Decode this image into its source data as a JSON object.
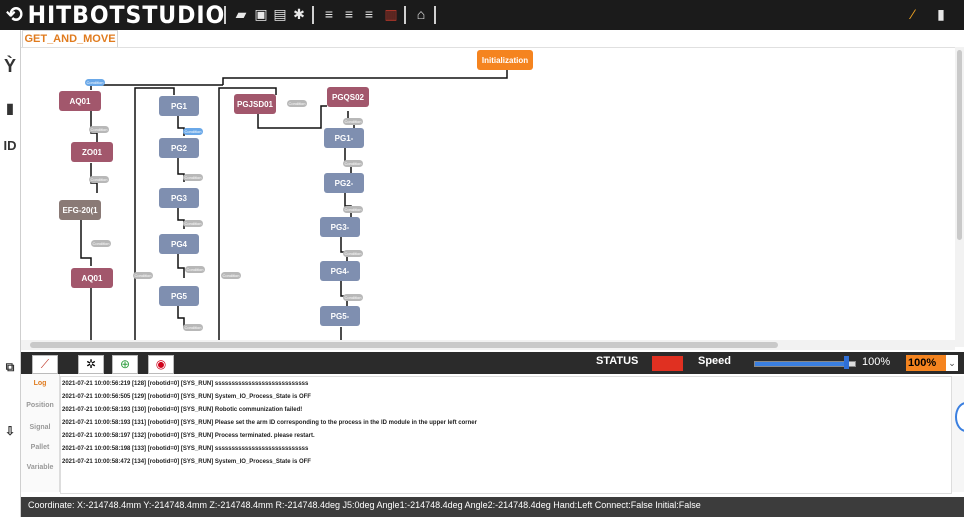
{
  "app": {
    "brand": "HITBOTSTUDIO"
  },
  "tabs": [
    {
      "label": "GET_AND_MOVE"
    }
  ],
  "flow": {
    "start": "Initialization",
    "col1": [
      "AQ01",
      "ZO01",
      "EFG-20(1",
      "AQ01"
    ],
    "col2": [
      "PG1",
      "PG2",
      "PG3",
      "PG4",
      "PG5"
    ],
    "col3_head": "PGJSD01",
    "col4": [
      "PGQS02",
      "PG1-",
      "PG2-",
      "PG3-",
      "PG4-",
      "PG5-"
    ],
    "condition_label": "Condition"
  },
  "toolbar": {
    "status_label": "STATUS",
    "status_color": "#e03021",
    "speed_label": "Speed",
    "speed_value": "100%",
    "speed_fraction": 1.0,
    "speed_select": "100%"
  },
  "side_tabs": [
    "Log",
    "Position",
    "Signal",
    "Pallet",
    "Variable"
  ],
  "log": [
    "2021-07-21 10:00:56:219 [128] [robotid=0] [SYS_RUN] ssssssssssssssssssssssssssss",
    "2021-07-21 10:00:56:505 [129] [robotid=0] [SYS_RUN] System_IO_Process_State is OFF",
    "2021-07-21 10:00:58:193 [130] [robotid=0] [SYS_RUN] Robotic  communization failed!",
    "2021-07-21 10:00:58:193 [131] [robotid=0] [SYS_RUN] Please set the arm ID corresponding to the process in the ID module in the upper left corner",
    "2021-07-21 10:00:58:197 [132] [robotid=0] [SYS_RUN] Process terminated. please restart.",
    "2021-07-21 10:00:58:198 [133] [robotid=0] [SYS_RUN] ssssssssssssssssssssssssssss",
    "2021-07-21 10:00:58:472 [134] [robotid=0] [SYS_RUN] System_IO_Process_State is OFF"
  ],
  "statusbar": {
    "text": "Coordinate:  X:-214748.4mm  Y:-214748.4mm  Z:-214748.4mm  R:-214748.4deg  J5:0deg  Angle1:-214748.4deg  Angle2:-214748.4deg  Hand:Left  Connect:False  Initial:False"
  },
  "icons": {
    "logo": "robot-arm-logo-icon",
    "toolbar": [
      "folder-open-icon",
      "image-icon",
      "save-icon",
      "settings-icon",
      "align-left-icon",
      "align-center-icon",
      "align-right-icon",
      "delete-icon",
      "home-icon",
      "wand-icon",
      "window-icon"
    ],
    "left": [
      "wrench-icon",
      "db-icon",
      "id-icon",
      "screenshot-icon",
      "export-icon"
    ],
    "tools": [
      "arm-icon",
      "bug-icon",
      "run-icon",
      "record-icon"
    ]
  }
}
